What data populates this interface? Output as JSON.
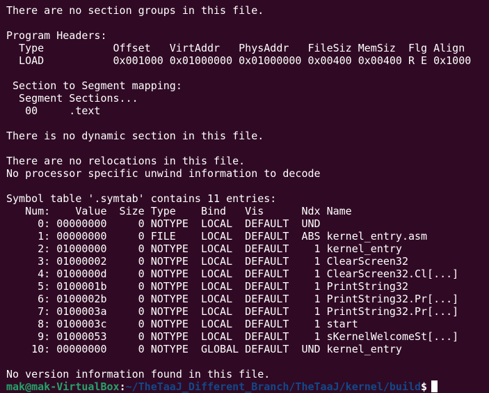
{
  "terminal": {
    "lines": [
      "There are no section groups in this file.",
      "",
      "Program Headers:",
      "  Type           Offset   VirtAddr   PhysAddr   FileSiz MemSiz  Flg Align",
      "  LOAD           0x001000 0x01000000 0x01000000 0x00400 0x00400 R E 0x1000",
      "",
      " Section to Segment mapping:",
      "  Segment Sections...",
      "   00     .text",
      "",
      "There is no dynamic section in this file.",
      "",
      "There are no relocations in this file.",
      "No processor specific unwind information to decode",
      "",
      "Symbol table '.symtab' contains 11 entries:",
      "   Num:    Value  Size Type    Bind   Vis      Ndx Name",
      "     0: 00000000     0 NOTYPE  LOCAL  DEFAULT  UND",
      "     1: 00000000     0 FILE    LOCAL  DEFAULT  ABS kernel_entry.asm",
      "     2: 01000000     0 NOTYPE  LOCAL  DEFAULT    1 kernel_entry",
      "     3: 01000002     0 NOTYPE  LOCAL  DEFAULT    1 ClearScreen32",
      "     4: 0100000d     0 NOTYPE  LOCAL  DEFAULT    1 ClearScreen32.Cl[...]",
      "     5: 0100001b     0 NOTYPE  LOCAL  DEFAULT    1 PrintString32",
      "     6: 0100002b     0 NOTYPE  LOCAL  DEFAULT    1 PrintString32.Pr[...]",
      "     7: 0100003a     0 NOTYPE  LOCAL  DEFAULT    1 PrintString32.Pr[...]",
      "     8: 0100003c     0 NOTYPE  LOCAL  DEFAULT    1 start",
      "     9: 01000053     0 NOTYPE  LOCAL  DEFAULT    1 sKernelWelcomeSt[...]",
      "    10: 00000000     0 NOTYPE  GLOBAL DEFAULT  UND kernel_entry",
      "",
      "No version information found in this file."
    ],
    "prompt": {
      "user_host": "mak@mak-VirtualBox",
      "colon": ":",
      "path": "~/TheTaaJ_Different_Branch/TheTaaJ/kernel/build",
      "dollar": "$"
    }
  },
  "colors": {
    "background": "#300a24",
    "text": "#ffffff",
    "prompt_user": "#26a269",
    "prompt_path": "#12488b"
  }
}
